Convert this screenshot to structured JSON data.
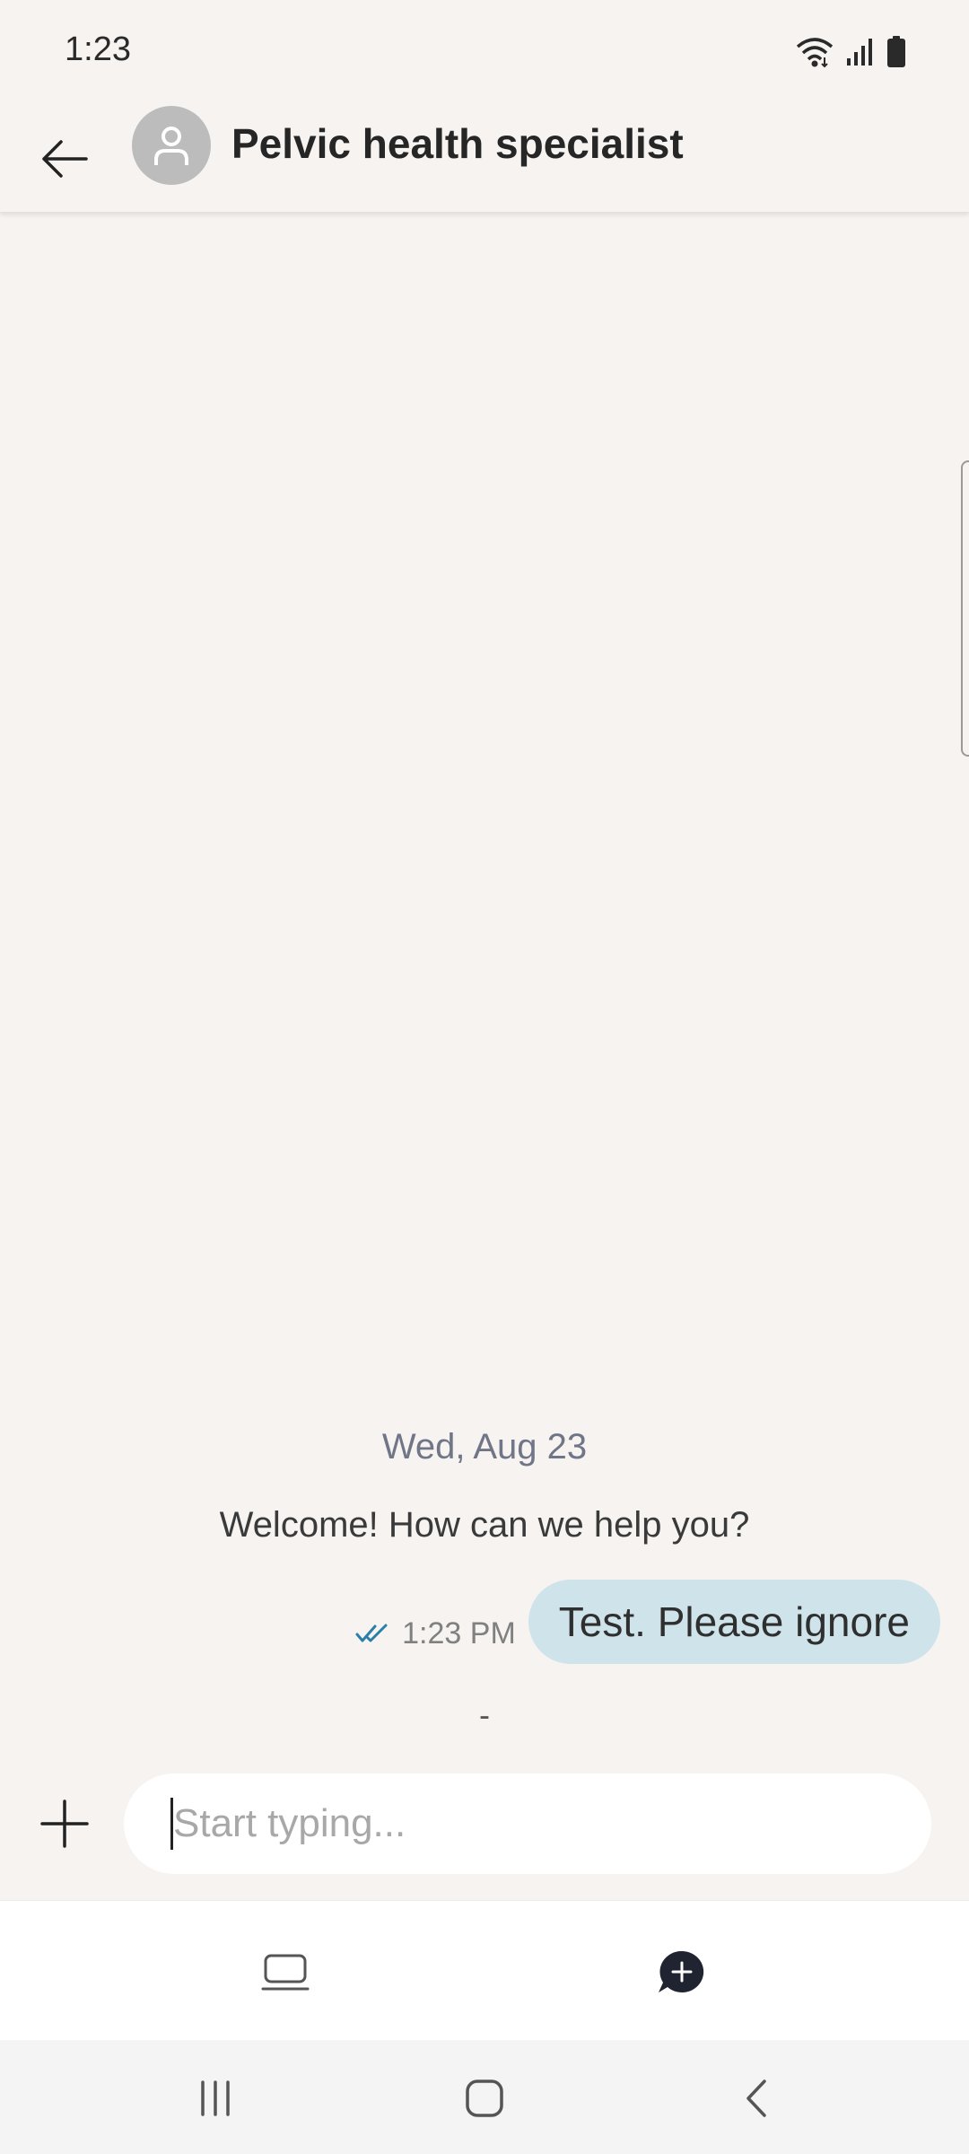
{
  "status_bar": {
    "time": "1:23",
    "icons": [
      "wifi-icon",
      "signal-icon",
      "battery-icon"
    ]
  },
  "header": {
    "back_icon": "arrow-left-icon",
    "avatar_icon": "person-icon",
    "title": "Pelvic health specialist"
  },
  "conversation": {
    "date_separator": "Wed, Aug 23",
    "welcome_text": "Welcome! How can we help you?",
    "messages": [
      {
        "text": "Test. Please ignore",
        "time": "1:23 PM",
        "status_icon": "double-check-icon",
        "sender": "self"
      }
    ],
    "trailing_text": "-"
  },
  "composer": {
    "add_icon": "plus-icon",
    "placeholder": "Start typing...",
    "value": ""
  },
  "bottom_nav": {
    "items": [
      {
        "icon": "laptop-icon"
      },
      {
        "icon": "chat-add-icon"
      }
    ]
  },
  "system_nav": {
    "items": [
      "recents-icon",
      "home-icon",
      "back-icon"
    ]
  },
  "colors": {
    "background": "#f6f3f1",
    "bubble": "#cfe4ea",
    "check": "#2a7fa8",
    "avatar": "#bcbcbc"
  }
}
